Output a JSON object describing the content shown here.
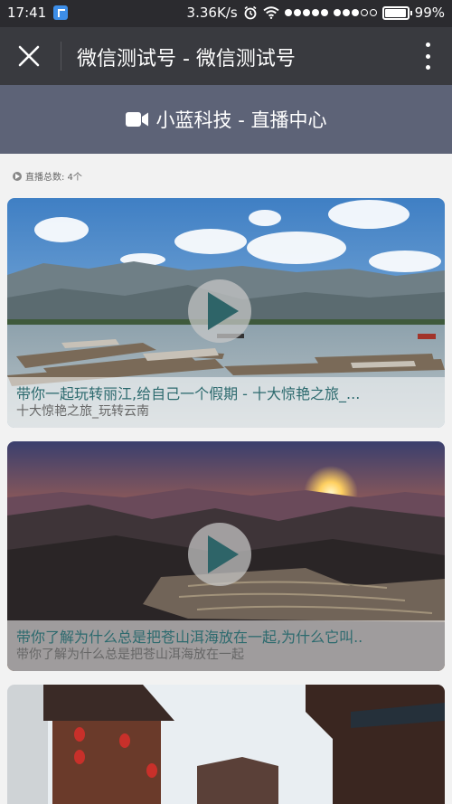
{
  "status_bar": {
    "time": "17:41",
    "speed": "3.36K/s",
    "battery": "99%",
    "battery_level": 0.99
  },
  "nav": {
    "title": "微信测试号 - 微信测试号"
  },
  "header": {
    "icon": "video-camera-icon",
    "title": "小蓝科技 - 直播中心"
  },
  "summary": {
    "live_count": "直播总数: 4个"
  },
  "videos": [
    {
      "title": "带你一起玩转丽江,给自己一个假期 - 十大惊艳之旅_...",
      "subtitle": "十大惊艳之旅_玩转云南"
    },
    {
      "title": "带你了解为什么总是把苍山洱海放在一起,为什么它叫..",
      "subtitle": "带你了解为什么总是把苍山洱海放在一起"
    }
  ],
  "colors": {
    "status_bar": "#2b2b2f",
    "nav_bar": "#393a3f",
    "header": "#5d6377",
    "play_triangle": "#2e6468",
    "caption_title": "#2c6a6e"
  }
}
